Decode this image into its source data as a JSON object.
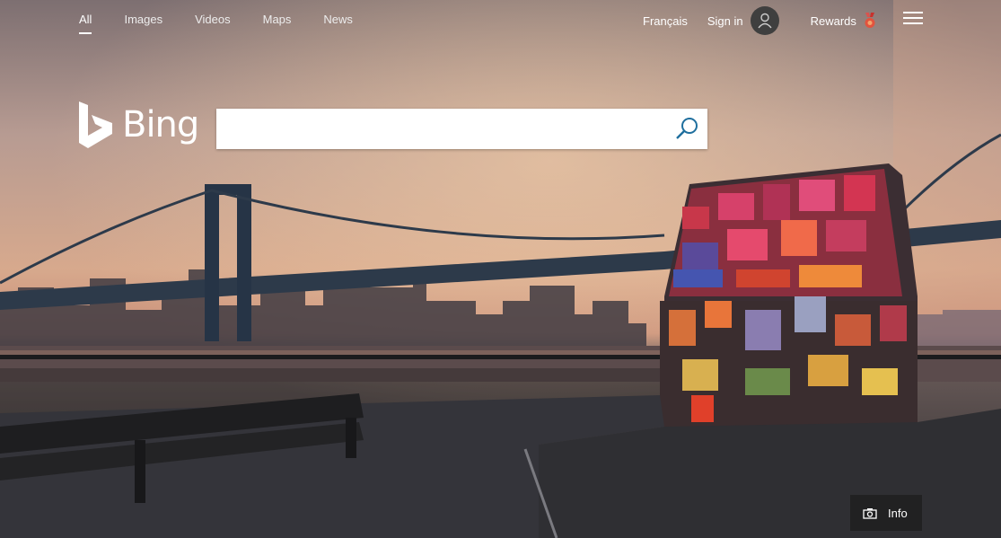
{
  "nav": {
    "tabs": [
      {
        "label": "All",
        "active": true
      },
      {
        "label": "Images"
      },
      {
        "label": "Videos"
      },
      {
        "label": "Maps"
      },
      {
        "label": "News"
      }
    ]
  },
  "header": {
    "language": "Français",
    "sign_in": "Sign in",
    "rewards": "Rewards",
    "icons": [
      "user-avatar-icon",
      "rewards-medal-icon",
      "menu-icon"
    ]
  },
  "logo": {
    "text": "Bing"
  },
  "search": {
    "value": "",
    "icon": "magnifier-icon"
  },
  "info": {
    "label": "Info",
    "icon": "camera-icon"
  },
  "colors": {
    "medal": "#d9534f",
    "search_icon": "#1f6f9e",
    "sky_top": "#7d6f71",
    "sky_glow": "#e2b892"
  }
}
